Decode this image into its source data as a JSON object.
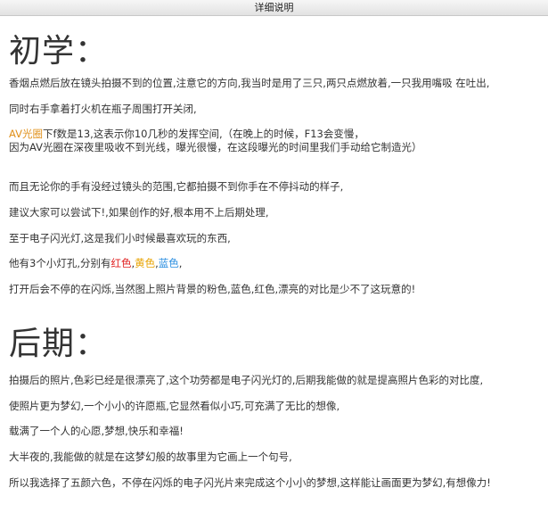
{
  "window": {
    "title": "详细说明"
  },
  "section1": {
    "heading": "初学：",
    "p1": "香烟点燃后放在镜头拍摄不到的位置,注意它的方向,我当时是用了三只,两只点燃放着,一只我用嘴吸 在吐出,",
    "p2": "同时右手拿着打火机在瓶子周围打开关闭,",
    "p3_highlight": "AV光圈",
    "p3_rest": "下f数是13,这表示你10几秒的发挥空间,（在晚上的时候，F13会变慢，",
    "p3_line2": "因为AV光圈在深夜里吸收不到光线，曝光很慢，在这段曝光的时间里我们手动给它制造光）",
    "p4": "而且无论你的手有没经过镜头的范围,它都拍摄不到你手在不停抖动的样子,",
    "p5": "建议大家可以尝试下!,如果创作的好,根本用不上后期处理,",
    "p6": "至于电子闪光灯,这是我们小时候最喜欢玩的东西,",
    "p7_prefix": "他有3个小灯孔,分别有",
    "p7_red": "红色",
    "p7_comma1": ",",
    "p7_yellow": "黄色",
    "p7_comma2": ",",
    "p7_blue": "蓝色",
    "p7_comma3": ",",
    "p8": "打开后会不停的在闪烁,当然图上照片背景的粉色,蓝色,红色,漂亮的对比是少不了这玩意的!"
  },
  "section2": {
    "heading": "后期：",
    "p1": "拍摄后的照片,色彩已经是很漂亮了,这个功劳都是电子闪光灯的,后期我能做的就是提高照片色彩的对比度,",
    "p2": "使照片更为梦幻,一个小小的许愿瓶,它显然看似小巧,可充满了无比的想像,",
    "p3": "载满了一个人的心愿,梦想,快乐和幸福!",
    "p4": "大半夜的,我能做的就是在这梦幻般的故事里为它画上一个句号,",
    "p5": "所以我选择了五颜六色，不停在闪烁的电子闪光片来完成这个小小的梦想,这样能让画面更为梦幻,有想像力!"
  },
  "colors": {
    "orange": "#e0901a",
    "red": "#e02020",
    "yellow": "#e8a300",
    "blue": "#2a8ee0"
  }
}
